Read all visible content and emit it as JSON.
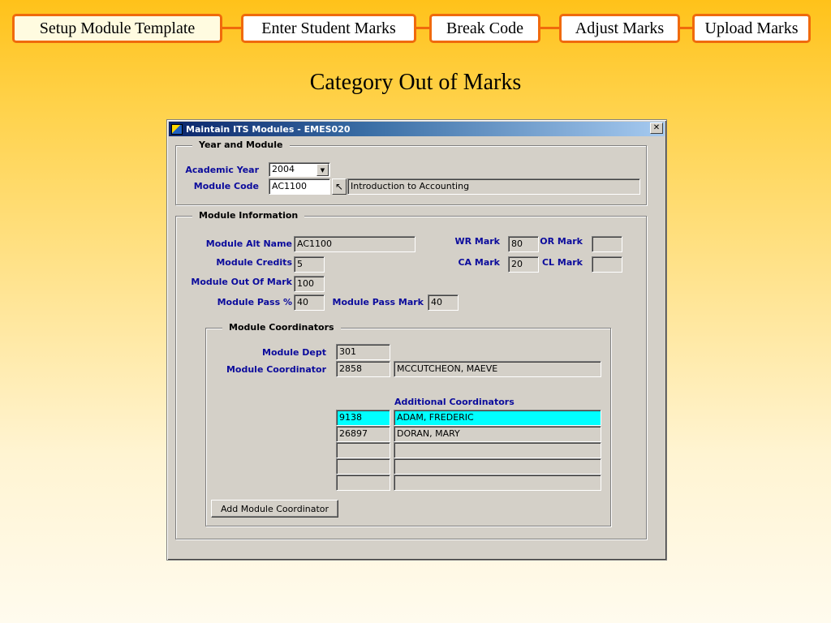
{
  "workflow": {
    "steps": [
      "Setup Module Template",
      "Enter Student Marks",
      "Break Code",
      "Adjust Marks",
      "Upload Marks"
    ]
  },
  "slide": {
    "title": "Category Out of Marks"
  },
  "window": {
    "title": "Maintain ITS Modules - EMES020",
    "close_label": "✕",
    "year_module": {
      "legend": "Year and Module",
      "academic_year_label": "Academic Year",
      "academic_year_value": "2004",
      "module_code_label": "Module Code",
      "module_code_value": "AC1100",
      "module_name_value": "Introduction to Accounting"
    },
    "module_info": {
      "legend": "Module Information",
      "alt_name_label": "Module Alt Name",
      "alt_name_value": "AC1100",
      "credits_label": "Module Credits",
      "credits_value": "5",
      "out_of_mark_label": "Module Out Of Mark",
      "out_of_mark_value": "100",
      "pass_pct_label": "Module Pass %",
      "pass_pct_value": "40",
      "pass_mark_label": "Module Pass Mark",
      "pass_mark_value": "40",
      "wr_mark_label": "WR Mark",
      "wr_mark_value": "80",
      "ca_mark_label": "CA Mark",
      "ca_mark_value": "20",
      "or_mark_label": "OR Mark",
      "or_mark_value": "",
      "cl_mark_label": "CL Mark",
      "cl_mark_value": ""
    },
    "coordinators": {
      "legend": "Module Coordinators",
      "dept_label": "Module Dept",
      "dept_value": "301",
      "coordinator_label": "Module Coordinator",
      "coordinator_id": "2858",
      "coordinator_name": "MCCUTCHEON, MAEVE",
      "additional_label": "Additional Coordinators",
      "additional": [
        {
          "id": "9138",
          "name": "ADAM, FREDERIC"
        },
        {
          "id": "26897",
          "name": "DORAN, MARY"
        },
        {
          "id": "",
          "name": ""
        },
        {
          "id": "",
          "name": ""
        },
        {
          "id": "",
          "name": ""
        }
      ],
      "add_button": "Add Module Coordinator"
    }
  }
}
